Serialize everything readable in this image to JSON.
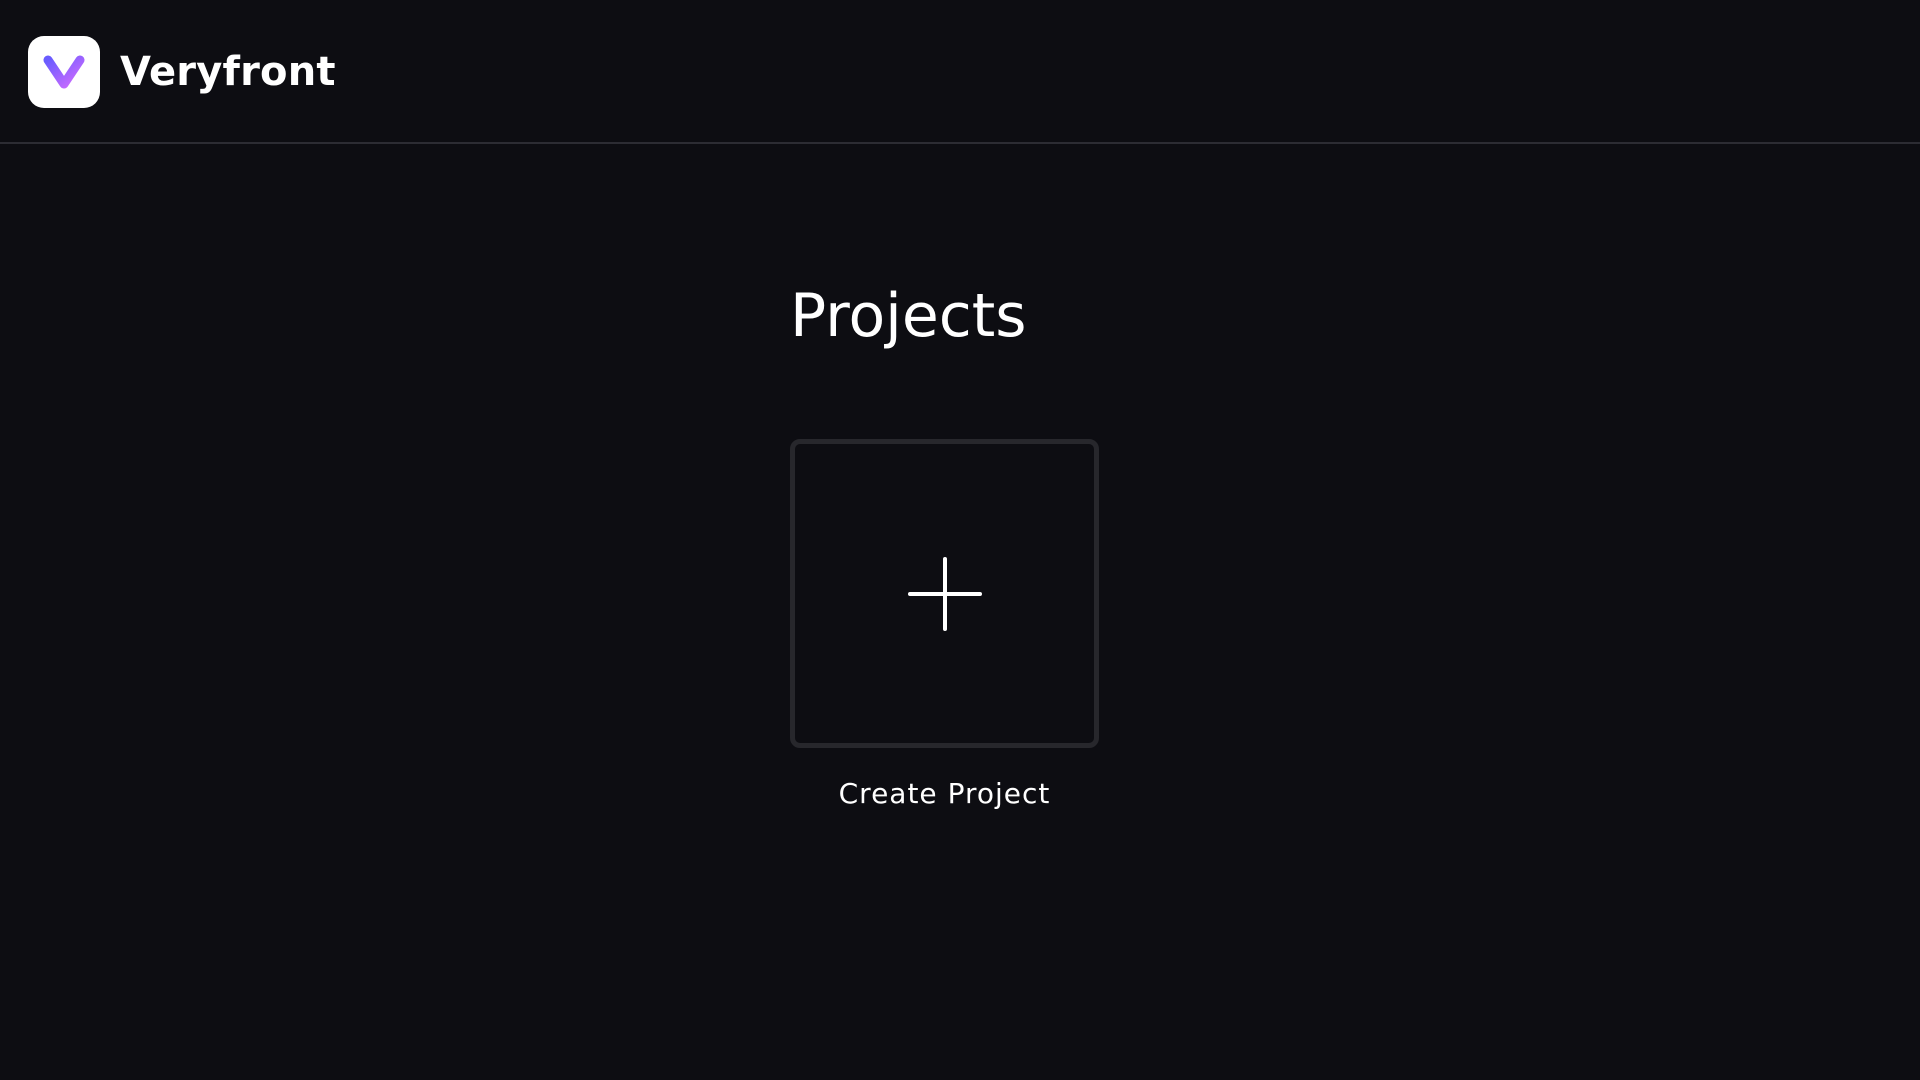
{
  "header": {
    "brand_name": "Veryfront",
    "logo_icon": "veryfront-v-logo-icon",
    "logo_colors": {
      "tile": "#ffffff",
      "gradient_start": "#6a5cff",
      "gradient_end": "#d06bff"
    }
  },
  "main": {
    "title": "Projects",
    "create_card": {
      "icon": "plus-icon",
      "label": "Create Project"
    }
  },
  "colors": {
    "background": "#0d0d12",
    "divider": "#2c2c33",
    "card_border": "#27272c",
    "text": "#ffffff"
  }
}
